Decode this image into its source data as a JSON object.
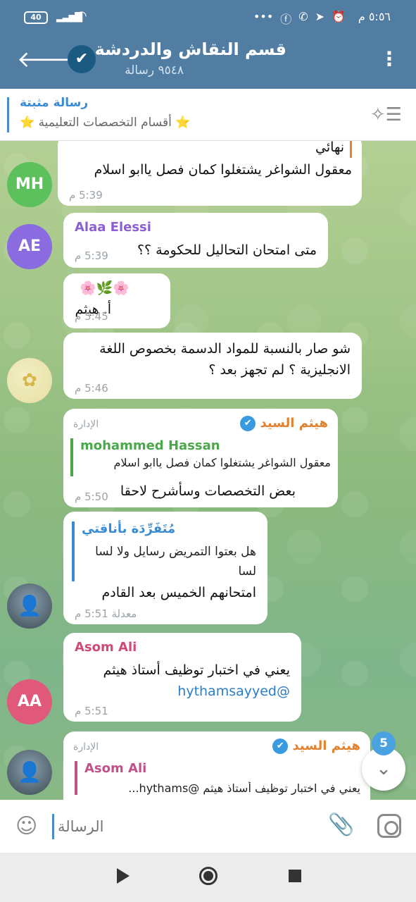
{
  "status_bar": {
    "time": "٥:٥٦ م",
    "battery": "40",
    "icons": [
      "facebook-icon",
      "whatsapp-icon",
      "telegram-icon",
      "alarm-icon"
    ]
  },
  "header": {
    "title": "قسم النقاش والدردشة",
    "subtitle": "٩٥٤٨ رسالة"
  },
  "pinned": {
    "label": "رسالة مثبتة",
    "text": "⭐ أقسام التخصصات التعليمية ⭐"
  },
  "messages": [
    {
      "reply_tail": "نهائي",
      "text": "معقول الشواغر يشتغلوا كمان فصل ياابو اسلام",
      "time": "5:39 م",
      "avatar": "MH",
      "avatar_color": "#5cc15c"
    },
    {
      "sender": "Alaa Elessi",
      "text": "متى امتحان التحاليل للحكومة ؟؟",
      "time": "5:39 م",
      "avatar": "AE",
      "avatar_color": "#8a6be0",
      "sender_color": "#8b5fd0"
    },
    {
      "line1": "🌸🌿🌸",
      "line2": "أ. هيثم",
      "time": "5:45 م"
    },
    {
      "text": "شو صار بالنسبة للمواد  الدسمة بخصوص اللغة الانجليزية ؟ لم تجهز بعد ؟",
      "time": "5:46 م"
    },
    {
      "sender": "هيثم السيد",
      "admin": "الإدارة",
      "reply_name": "mohammed Hassan",
      "reply_text": "معقول الشواغر يشتغلوا كمان فصل ياابو اسلام",
      "text": "بعض التخصصات وسأشرح لاحقا",
      "time": "5:50 م",
      "sender_color": "#e0822f",
      "reply_color": "#4aa84a"
    },
    {
      "reply_name": "مُتَفَرِّدَة بأناقتي",
      "reply_line1": "هل بعتوا التمريض رسايل ولا لسا",
      "reply_line2": "لسا",
      "text": "امتحانهم الخميس بعد القادم",
      "time": "معدلة 5:51 م",
      "reply_color": "#3a8bd1"
    },
    {
      "sender": "Asom Ali",
      "text": "يعني في اختبار توظيف أستاذ هيثم",
      "mention": "@hythamsayyed",
      "time": "5:51 م",
      "avatar": "AA",
      "avatar_color": "#e0587a",
      "sender_color": "#d0487a"
    },
    {
      "sender": "هيثم السيد",
      "admin": "الإدارة",
      "reply_name": "Asom Ali",
      "reply_text": "يعني في اختبار توظيف أستاذ هيثم @hythams...",
      "sender_color": "#e0822f",
      "reply_color": "#c0508a"
    }
  ],
  "scroll_badge": "5",
  "input": {
    "placeholder": "الرسالة"
  }
}
